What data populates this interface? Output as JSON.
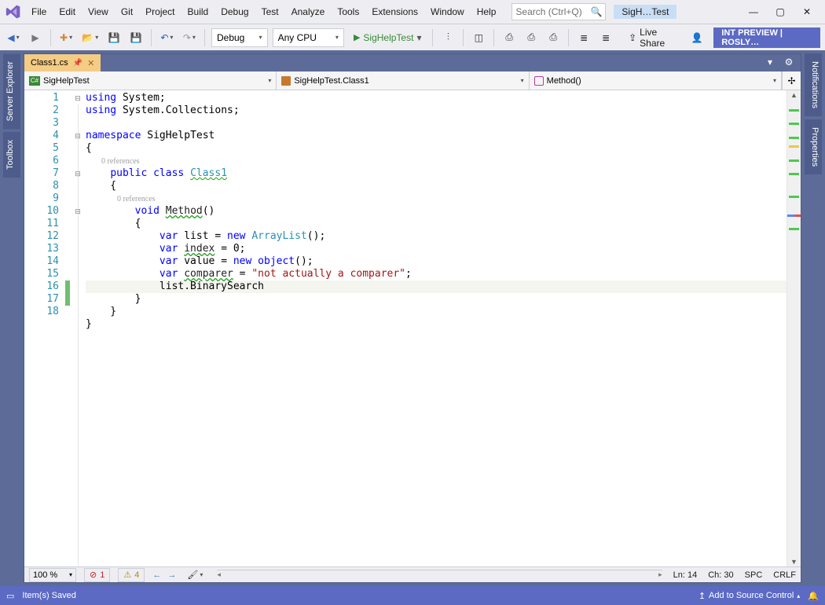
{
  "menu": [
    "File",
    "Edit",
    "View",
    "Git",
    "Project",
    "Build",
    "Debug",
    "Test",
    "Analyze",
    "Tools",
    "Extensions",
    "Window",
    "Help"
  ],
  "search_placeholder": "Search (Ctrl+Q)",
  "app_tag": "SigH…Test",
  "toolbar": {
    "config": "Debug",
    "platform": "Any CPU",
    "start": "SigHelpTest",
    "live_share": "Live Share",
    "preview": "INT PREVIEW | ROSLY…"
  },
  "left_wells": [
    "Server Explorer",
    "Toolbox"
  ],
  "right_wells": [
    "Notifications",
    "Properties"
  ],
  "doc": {
    "tab": "Class1.cs",
    "nav_project": "SigHelpTest",
    "nav_class": "SigHelpTest.Class1",
    "nav_member": "Method()",
    "cs_badge": "C#"
  },
  "code": {
    "lines": [
      {
        "n": 1,
        "fold": "⊟",
        "t": [
          [
            "kw",
            "using"
          ],
          [
            " System;"
          ]
        ]
      },
      {
        "n": 2,
        "t": [
          [
            "kw",
            "using"
          ],
          [
            " System.Collections;"
          ]
        ]
      },
      {
        "n": 3,
        "t": [
          [
            ""
          ]
        ]
      },
      {
        "n": 4,
        "fold": "⊟",
        "t": [
          [
            "kw",
            "namespace"
          ],
          [
            " SigHelpTest"
          ]
        ]
      },
      {
        "n": 5,
        "t": [
          [
            "",
            "{"
          ]
        ]
      },
      {
        "ref": "0 references"
      },
      {
        "n": 6,
        "fold": "⊟",
        "t": [
          [
            "",
            "    "
          ],
          [
            "kw",
            "public"
          ],
          [
            " "
          ],
          [
            "kw",
            "class"
          ],
          [
            " "
          ],
          [
            "type squiggle",
            "Class1"
          ]
        ]
      },
      {
        "n": 7,
        "t": [
          [
            "",
            "    {"
          ]
        ]
      },
      {
        "ref": "0 references",
        "pad": 8
      },
      {
        "n": 8,
        "fold": "⊟",
        "t": [
          [
            "",
            "        "
          ],
          [
            "kw",
            "void"
          ],
          [
            " "
          ],
          [
            "ident squiggle-warn",
            "Method"
          ],
          [
            "()"
          ]
        ]
      },
      {
        "n": 9,
        "t": [
          [
            "",
            "        {"
          ]
        ]
      },
      {
        "n": 10,
        "t": [
          [
            "",
            "            "
          ],
          [
            "kw",
            "var"
          ],
          [
            " list = "
          ],
          [
            "kw",
            "new"
          ],
          [
            " "
          ],
          [
            "type",
            "ArrayList"
          ],
          [
            "();"
          ]
        ]
      },
      {
        "n": 11,
        "t": [
          [
            "",
            "            "
          ],
          [
            "kw",
            "var"
          ],
          [
            " "
          ],
          [
            "ident squiggle-warn",
            "index"
          ],
          [
            " = 0;"
          ]
        ]
      },
      {
        "n": 12,
        "t": [
          [
            "",
            "            "
          ],
          [
            "kw",
            "var"
          ],
          [
            " value = "
          ],
          [
            "kw",
            "new"
          ],
          [
            " "
          ],
          [
            "kw",
            "object"
          ],
          [
            "();"
          ]
        ]
      },
      {
        "n": 13,
        "t": [
          [
            "",
            "            "
          ],
          [
            "kw",
            "var"
          ],
          [
            " "
          ],
          [
            "ident squiggle-warn",
            "comparer"
          ],
          [
            " = "
          ],
          [
            "str",
            "\"not actually a comparer\""
          ],
          [
            ";"
          ]
        ]
      },
      {
        "n": 14,
        "current": true,
        "chg": "green",
        "t": [
          [
            "",
            "            list.BinarySearch"
          ]
        ]
      },
      {
        "n": 15,
        "chg": "green",
        "t": [
          [
            "",
            "        }"
          ]
        ]
      },
      {
        "n": 16,
        "t": [
          [
            "",
            "    }"
          ]
        ]
      },
      {
        "n": 17,
        "t": [
          [
            "",
            "}"
          ]
        ]
      },
      {
        "n": 18,
        "t": [
          [
            ""
          ]
        ]
      }
    ]
  },
  "footer": {
    "zoom": "100 %",
    "errors": "1",
    "warnings": "4",
    "ln": "Ln: 14",
    "ch": "Ch: 30",
    "ins": "SPC",
    "le": "CRLF"
  },
  "status": {
    "left": "Item(s) Saved",
    "src_ctrl": "Add to Source Control"
  }
}
